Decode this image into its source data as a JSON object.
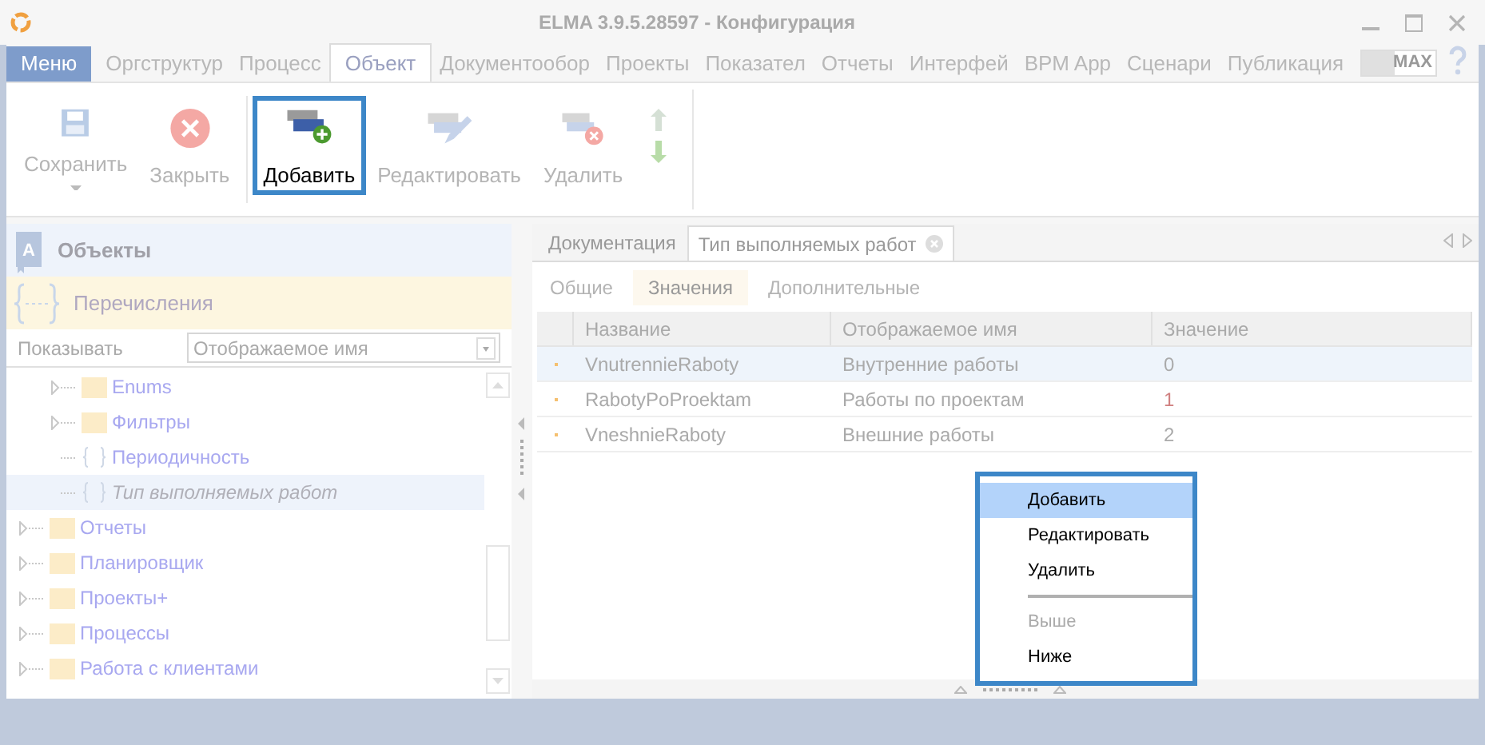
{
  "window": {
    "title": "ELMA 3.9.5.28597 - Конфигурация"
  },
  "menu_button": "Меню",
  "ribbon_tabs": [
    {
      "label": "Оргструктур",
      "selected": false
    },
    {
      "label": "Процесс",
      "selected": false
    },
    {
      "label": "Объект",
      "selected": true
    },
    {
      "label": "Документообор",
      "selected": false
    },
    {
      "label": "Проекты",
      "selected": false
    },
    {
      "label": "Показател",
      "selected": false
    },
    {
      "label": "Отчеты",
      "selected": false
    },
    {
      "label": "Интерфей",
      "selected": false
    },
    {
      "label": "BPM App",
      "selected": false
    },
    {
      "label": "Сценари",
      "selected": false
    },
    {
      "label": "Публикация",
      "selected": false
    }
  ],
  "max_label": "MAX",
  "toolbar": {
    "buttons": [
      {
        "kind": "save",
        "label": "Сохранить",
        "disabled": true,
        "highlighted": false
      },
      {
        "kind": "close",
        "label": "Закрыть",
        "disabled": true,
        "highlighted": false
      },
      {
        "kind": "add",
        "label": "Добавить",
        "disabled": false,
        "highlighted": true
      },
      {
        "kind": "edit",
        "label": "Редактировать",
        "disabled": true,
        "highlighted": false
      },
      {
        "kind": "delete",
        "label": "Удалить",
        "disabled": true,
        "highlighted": false
      }
    ]
  },
  "sidebar": {
    "sections": [
      {
        "kind": "objects",
        "label": "Объекты",
        "icon_letter": "A",
        "selected": false
      },
      {
        "kind": "enums",
        "label": "Перечисления",
        "selected": true
      }
    ],
    "show_label": "Показывать",
    "show_value": "Отображаемое имя",
    "tree": [
      {
        "kind": "group",
        "children": [
          {
            "kind": "folder",
            "label": "Enums",
            "selected": false
          },
          {
            "kind": "folder",
            "label": "Фильтры",
            "selected": false
          },
          {
            "kind": "enum",
            "label": "Периодичность",
            "selected": false
          },
          {
            "kind": "enum",
            "label": "Тип выполняемых работ",
            "selected": true
          }
        ]
      },
      {
        "kind": "folder",
        "label": "Отчеты",
        "selected": false
      },
      {
        "kind": "folder",
        "label": "Планировщик",
        "selected": false
      },
      {
        "kind": "folder",
        "label": "Проекты+",
        "selected": false
      },
      {
        "kind": "folder",
        "label": "Процессы",
        "selected": false
      },
      {
        "kind": "folder",
        "label": "Работа с клиентами",
        "selected": false
      }
    ]
  },
  "doc_tabs": [
    {
      "label": "Документация",
      "selected": false
    },
    {
      "label": "Тип выполняемых работ",
      "selected": true
    }
  ],
  "sub_tabs": [
    {
      "label": "Общие",
      "selected": false
    },
    {
      "label": "Значения",
      "selected": true
    },
    {
      "label": "Дополнительные",
      "selected": false
    }
  ],
  "table": {
    "columns": [
      "Название",
      "Отображаемое имя",
      "Значение"
    ],
    "rows": [
      {
        "cells": [
          "VnutrennieRaboty",
          "Внутренние работы",
          "0"
        ],
        "selected": true
      },
      {
        "cells": [
          "RabotyPoProektam",
          "Работы по проектам",
          "1"
        ],
        "selected": false
      },
      {
        "cells": [
          "VneshnieRaboty",
          "Внешние работы",
          "2"
        ],
        "selected": false
      }
    ]
  },
  "context_menu": [
    {
      "kind": "item",
      "label": "Добавить",
      "highlighted": true,
      "disabled": false
    },
    {
      "kind": "item",
      "label": "Редактировать",
      "highlighted": false,
      "disabled": false
    },
    {
      "kind": "item",
      "label": "Удалить",
      "highlighted": false,
      "disabled": false
    },
    {
      "kind": "separator"
    },
    {
      "kind": "item",
      "label": "Выше",
      "highlighted": false,
      "disabled": true
    },
    {
      "kind": "item",
      "label": "Ниже",
      "highlighted": false,
      "disabled": false
    }
  ]
}
